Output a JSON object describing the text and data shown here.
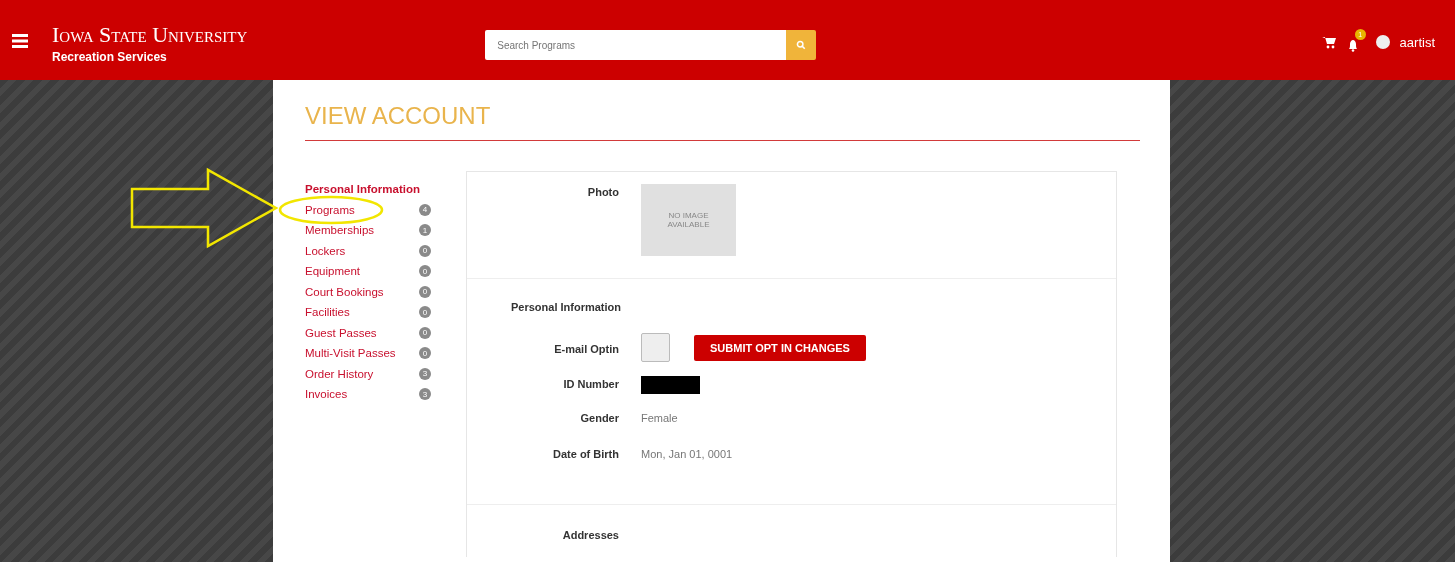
{
  "header": {
    "title": "Iowa State University",
    "subtitle": "Recreation Services",
    "search": {
      "placeholder": "Search Programs"
    },
    "notification_count": "1",
    "username": "aartist"
  },
  "page": {
    "title": "VIEW ACCOUNT"
  },
  "sidebar": {
    "items": [
      {
        "label": "Personal Information",
        "selected": true
      },
      {
        "label": "Programs",
        "count": "4",
        "selected": false,
        "circled": true
      },
      {
        "label": "Memberships",
        "count": "1",
        "selected": false
      },
      {
        "label": "Lockers",
        "count": "0",
        "selected": false
      },
      {
        "label": "Equipment",
        "count": "0",
        "selected": false
      },
      {
        "label": "Court Bookings",
        "count": "0",
        "selected": false
      },
      {
        "label": "Facilities",
        "count": "0",
        "selected": false
      },
      {
        "label": "Guest Passes",
        "count": "0",
        "selected": false
      },
      {
        "label": "Multi-Visit Passes",
        "count": "0",
        "selected": false
      },
      {
        "label": "Order History",
        "count": "3",
        "selected": false
      },
      {
        "label": "Invoices",
        "count": "3",
        "selected": false
      }
    ]
  },
  "photo": {
    "label": "Photo",
    "placeholder_text": "NO IMAGE AVAILABLE"
  },
  "personal_information": {
    "heading": "Personal Information",
    "fields": [
      {
        "kind": "checkbox",
        "label": "E-mail Optin",
        "checked": false,
        "button": "SUBMIT OPT IN CHANGES"
      },
      {
        "kind": "redacted",
        "label": "ID Number"
      },
      {
        "kind": "text",
        "label": "Gender",
        "value": "Female"
      },
      {
        "kind": "text",
        "label": "Date of Birth",
        "value": "Mon, Jan 01, 0001"
      }
    ]
  },
  "addresses": {
    "heading": "Addresses"
  }
}
